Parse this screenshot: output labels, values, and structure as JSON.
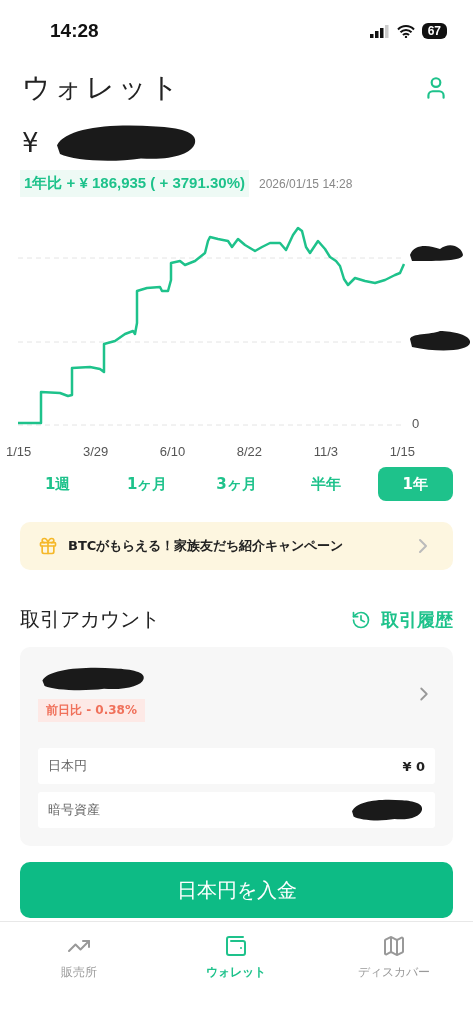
{
  "status_bar": {
    "time": "14:28",
    "battery": "67"
  },
  "header": {
    "title": "ウォレット"
  },
  "balance": {
    "currency": "¥"
  },
  "change": {
    "text": "1年比 + ¥ 186,935 ( + 3791.30%)",
    "timestamp": "2026/01/15 14:28"
  },
  "chart": {
    "y_label": "0",
    "x_labels": [
      "1/15",
      "3/29",
      "6/10",
      "8/22",
      "11/3",
      "1/15"
    ]
  },
  "periods": [
    {
      "label": "1週",
      "selected": false
    },
    {
      "label": "1ヶ月",
      "selected": false
    },
    {
      "label": "3ヶ月",
      "selected": false
    },
    {
      "label": "半年",
      "selected": false
    },
    {
      "label": "1年",
      "selected": true
    }
  ],
  "banner": {
    "text": "BTCがもらえる！家族友だち紹介キャンペーン"
  },
  "section": {
    "title": "取引アカウント",
    "link": "取引履歴"
  },
  "account": {
    "change": "前日比 - 0.38%",
    "rows": [
      {
        "label": "日本円",
        "value": "¥ 0"
      },
      {
        "label": "暗号資産"
      }
    ]
  },
  "deposit_button": "日本円を入金",
  "nav": [
    {
      "label": "販売所",
      "selected": false
    },
    {
      "label": "ウォレット",
      "selected": true
    },
    {
      "label": "ディスカバー",
      "selected": false
    }
  ]
}
